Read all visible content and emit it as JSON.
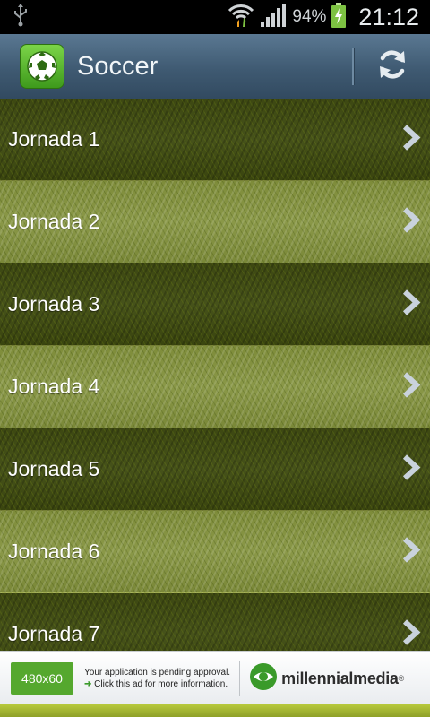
{
  "status_bar": {
    "battery_percent": "94%",
    "time": "21:12",
    "icons": [
      "usb-icon",
      "wifi-icon",
      "signal-icon",
      "battery-charging-icon"
    ]
  },
  "action_bar": {
    "title": "Soccer",
    "app_icon": "soccer-ball-icon",
    "action_icon": "refresh-icon"
  },
  "list": {
    "items": [
      {
        "label": "Jornada 1"
      },
      {
        "label": "Jornada 2"
      },
      {
        "label": "Jornada 3"
      },
      {
        "label": "Jornada 4"
      },
      {
        "label": "Jornada 5"
      },
      {
        "label": "Jornada 6"
      },
      {
        "label": "Jornada 7"
      }
    ]
  },
  "ad": {
    "size_label": "480x60",
    "message_line1": "Your application is pending approval.",
    "message_line2": "Click this ad for more information.",
    "brand": "millennialmedia",
    "brand_mark": "®"
  },
  "colors": {
    "action_bar": "#3f5a72",
    "grass_dark": "#46521a",
    "grass_light": "#8a9848",
    "ad_green": "#55a82e"
  }
}
